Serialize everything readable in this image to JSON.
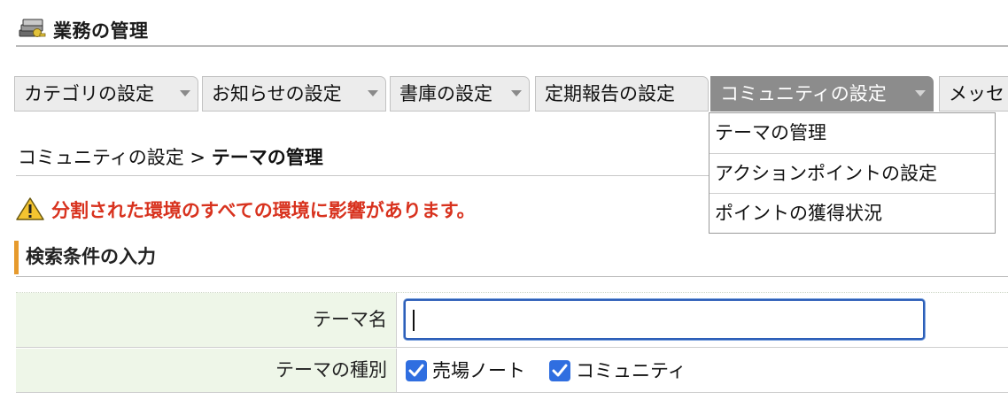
{
  "header": {
    "title": "業務の管理",
    "icon": "book-stack-icon"
  },
  "tabs": [
    {
      "label": "カテゴリの設定",
      "has_dropdown": true
    },
    {
      "label": "お知らせの設定",
      "has_dropdown": true
    },
    {
      "label": "書庫の設定",
      "has_dropdown": true
    },
    {
      "label": "定期報告の設定",
      "has_dropdown": false
    },
    {
      "label": "コミュニティの設定",
      "has_dropdown": true,
      "active": true
    },
    {
      "label": "メッセ",
      "has_dropdown": false
    }
  ],
  "dropdown": {
    "items": [
      {
        "label": "テーマの管理"
      },
      {
        "label": "アクションポイントの設定"
      },
      {
        "label": "ポイントの獲得状況"
      }
    ]
  },
  "breadcrumb": {
    "parent": "コミュニティの設定",
    "separator": " > ",
    "current": "テーマの管理"
  },
  "warning": {
    "text": "分割された環境のすべての環境に影響があります。",
    "icon": "warning-triangle-icon"
  },
  "section": {
    "title": "検索条件の入力"
  },
  "form": {
    "theme_name": {
      "label": "テーマ名",
      "value": ""
    },
    "theme_type": {
      "label": "テーマの種別",
      "options": [
        {
          "label": "売場ノート",
          "checked": true
        },
        {
          "label": "コミュニティ",
          "checked": true
        }
      ]
    }
  },
  "colors": {
    "warning_text": "#d8321e",
    "section_accent": "#e69a2d",
    "active_tab": "#8c8c8c",
    "label_cell_bg": "#eef6e8",
    "checkbox": "#2f6ee0",
    "input_focus": "#2d5fb8"
  }
}
